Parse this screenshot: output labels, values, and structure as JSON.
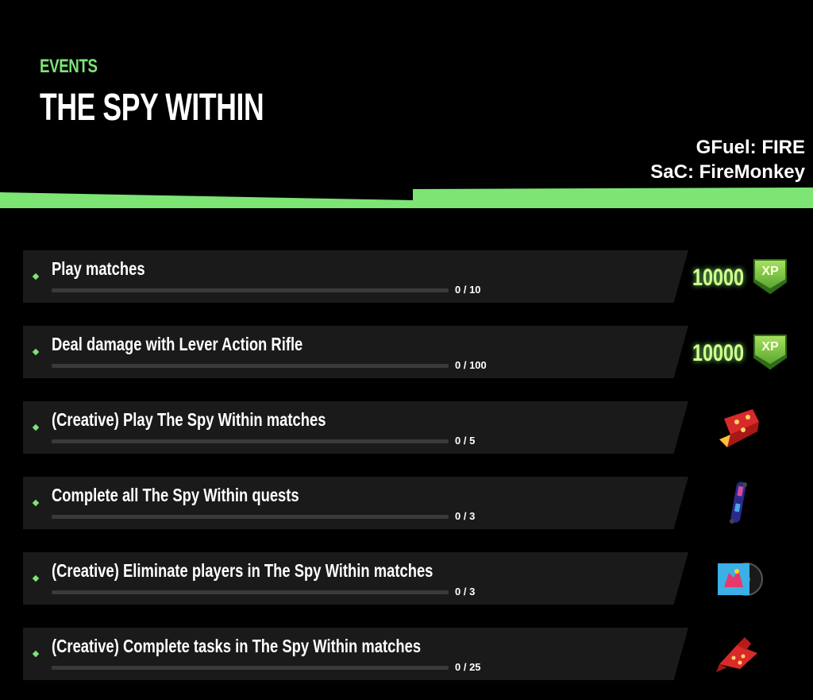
{
  "header": {
    "category": "EVENTS",
    "title": "THE SPY WITHIN",
    "credits": [
      "GFuel: FIRE",
      "SaC: FireMonkey"
    ]
  },
  "colors": {
    "accent": "#7ce574",
    "panel": "#1a1a1a",
    "background": "#000000",
    "xp_text": "#d5ff8c"
  },
  "quests": [
    {
      "title": "Play matches",
      "progress_text": "0 / 10",
      "progress": 0,
      "reward": {
        "type": "xp",
        "amount": "10000",
        "label": "XP",
        "icon": "xp-badge-icon"
      }
    },
    {
      "title": "Deal damage with Lever Action Rifle",
      "progress_text": "0 / 100",
      "progress": 0,
      "reward": {
        "type": "xp",
        "amount": "10000",
        "label": "XP",
        "icon": "xp-badge-icon"
      }
    },
    {
      "title": "(Creative) Play The Spy Within matches",
      "progress_text": "0 / 5",
      "progress": 0,
      "reward": {
        "type": "item",
        "icon": "wrap-icon"
      }
    },
    {
      "title": "Complete all The Spy Within quests",
      "progress_text": "0 / 3",
      "progress": 0,
      "reward": {
        "type": "item",
        "icon": "skateboard-icon"
      }
    },
    {
      "title": "(Creative) Eliminate players in The Spy Within matches",
      "progress_text": "0 / 3",
      "progress": 0,
      "reward": {
        "type": "item",
        "icon": "music-pack-icon"
      }
    },
    {
      "title": "(Creative) Complete tasks in The Spy Within matches",
      "progress_text": "0 / 25",
      "progress": 0,
      "reward": {
        "type": "item",
        "icon": "bandana-icon"
      }
    }
  ]
}
